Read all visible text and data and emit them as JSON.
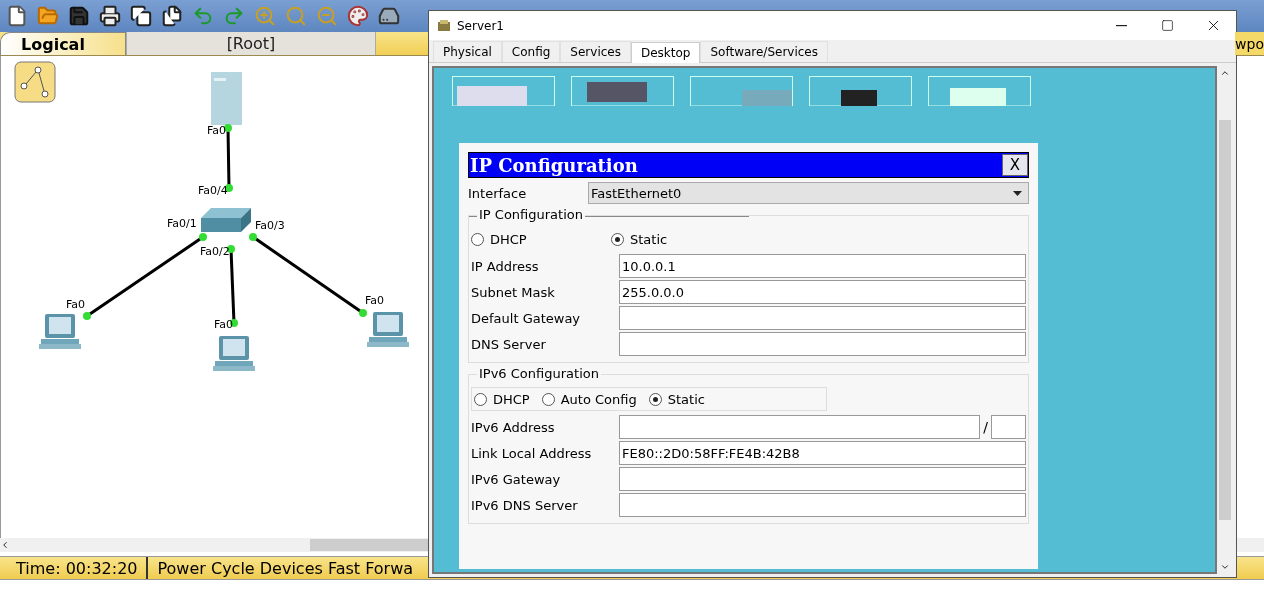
{
  "workspace": {
    "tabs": [
      {
        "label": "Logical",
        "selected": true
      }
    ],
    "breadcrumb": "[Root]",
    "edge_text": "wpo"
  },
  "topology": {
    "port_labels": [
      {
        "text": "Fa0"
      },
      {
        "text": "Fa0/4"
      },
      {
        "text": "Fa0/1"
      },
      {
        "text": "Fa0/2"
      },
      {
        "text": "Fa0/3"
      },
      {
        "text": "Fa0"
      },
      {
        "text": "Fa0"
      },
      {
        "text": "Fa0"
      }
    ]
  },
  "status_bar": {
    "time": "Time: 00:32:20",
    "actions": "Power Cycle Devices Fast Forwa"
  },
  "window": {
    "title": "Server1",
    "tabs": [
      {
        "label": "Physical",
        "selected": false
      },
      {
        "label": "Config",
        "selected": false
      },
      {
        "label": "Services",
        "selected": false
      },
      {
        "label": "Desktop",
        "selected": true
      },
      {
        "label": "Software/Services",
        "selected": false
      }
    ],
    "dialog": {
      "title": "IP Configuration",
      "close": "X",
      "interface_label": "Interface",
      "interface_value": "FastEthernet0",
      "ipv4": {
        "legend": "IP Configuration",
        "modes": [
          {
            "label": "DHCP",
            "selected": false
          },
          {
            "label": "Static",
            "selected": true
          }
        ],
        "fields": [
          {
            "label": "IP Address",
            "value": "10.0.0.1"
          },
          {
            "label": "Subnet Mask",
            "value": "255.0.0.0"
          },
          {
            "label": "Default Gateway"
          },
          {
            "label": "DNS Server"
          }
        ]
      },
      "ipv6": {
        "legend": "IPv6 Configuration",
        "modes": [
          {
            "label": "DHCP",
            "selected": false
          },
          {
            "label": "Auto Config",
            "selected": false
          },
          {
            "label": "Static",
            "selected": true
          }
        ],
        "fields": [
          {
            "label": "IPv6 Address",
            "kind": "prefixed",
            "separator": "/"
          },
          {
            "label": "Link Local Address",
            "value": "FE80::2D0:58FF:FE4B:42B8",
            "kind": "plain"
          },
          {
            "label": "IPv6 Gateway",
            "kind": "plain"
          },
          {
            "label": "IPv6 DNS Server",
            "kind": "plain"
          }
        ]
      }
    }
  }
}
